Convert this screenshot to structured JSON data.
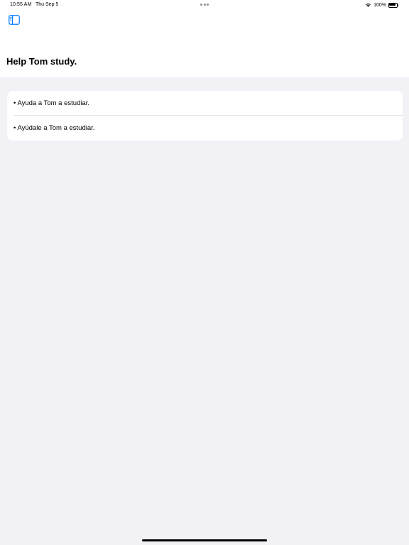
{
  "status_bar": {
    "time": "10:55 AM",
    "date": "Thu Sep 5",
    "battery_percent": "100%",
    "battery_level": 1.0,
    "icons": [
      "wifi-icon",
      "battery-icon"
    ]
  },
  "toolbar": {
    "sidebar_toggle_icon": "sidebar-left-icon",
    "accent_color": "#007aff"
  },
  "page": {
    "title": "Help Tom study."
  },
  "translations": [
    {
      "text": "• Ayuda a Tom a estudiar."
    },
    {
      "text": "• Ayúdale a Tom a estudiar."
    }
  ]
}
